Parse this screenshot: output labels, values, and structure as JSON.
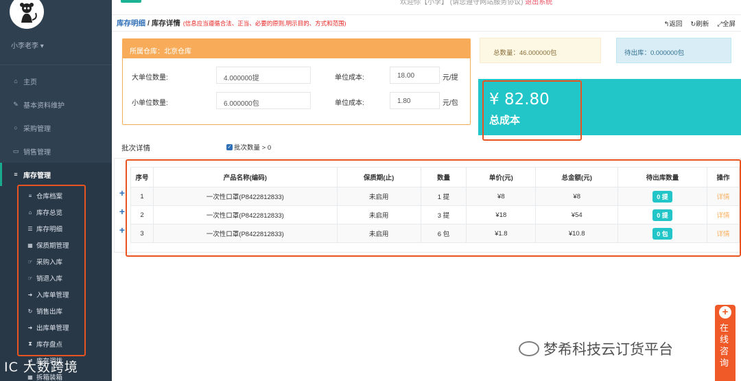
{
  "sidebar": {
    "user_name": "小李老李 ▾",
    "items": [
      {
        "icon": "home-icon",
        "glyph": "⌂",
        "label": "主页"
      },
      {
        "icon": "pencil-icon",
        "glyph": "✎",
        "label": "基本资料维护"
      },
      {
        "icon": "circle-icon",
        "glyph": "○",
        "label": "采购管理"
      },
      {
        "icon": "monitor-icon",
        "glyph": "▭",
        "label": "销售管理"
      },
      {
        "icon": "database-icon",
        "glyph": "≡",
        "label": "库存管理"
      }
    ],
    "submenu": [
      {
        "icon": "database-icon",
        "glyph": "≡",
        "label": "仓库档案"
      },
      {
        "icon": "bank-icon",
        "glyph": "⌂",
        "label": "库存总览"
      },
      {
        "icon": "list-icon",
        "glyph": "☰",
        "label": "库存明细"
      },
      {
        "icon": "calendar-icon",
        "glyph": "▦",
        "label": "保质期管理"
      },
      {
        "icon": "hand-icon",
        "glyph": "☞",
        "label": "采购入库"
      },
      {
        "icon": "hand-icon",
        "glyph": "☞",
        "label": "销退入库"
      },
      {
        "icon": "sign-in-icon",
        "glyph": "➜",
        "label": "入库单管理"
      },
      {
        "icon": "refresh-icon",
        "glyph": "↻",
        "label": "销售出库"
      },
      {
        "icon": "sign-out-icon",
        "glyph": "➜",
        "label": "出库单管理"
      },
      {
        "icon": "hourglass-icon",
        "glyph": "⧗",
        "label": "库存盘点"
      },
      {
        "icon": "exchange-icon",
        "glyph": "⇄",
        "label": "库存调拨"
      },
      {
        "icon": "table-icon",
        "glyph": "▦",
        "label": "拆箱装箱"
      }
    ]
  },
  "watermark_left": "IC 大数跨境",
  "topbar": {
    "text": "欢迎你【小李】 (请您遵守网站服务协议) ",
    "link": "退出系统"
  },
  "breadcrumb": {
    "parent": "库存明细",
    "sep": " / ",
    "current": "库存详情",
    "note": "(信息应当遵循合法、正当、必要的原则,明示目的、方式和范围)",
    "back": "↰返回",
    "refresh": "↻刷新",
    "fullscreen": "⤢全屏"
  },
  "warehouse": {
    "header": "所属仓库：北京仓库",
    "big_qty_label": "大单位数量:",
    "big_qty_value": "4.000000提",
    "big_cost_label": "单位成本:",
    "big_cost_value": "18.00",
    "big_cost_unit": "元/提",
    "small_qty_label": "小单位数量:",
    "small_qty_value": "6.000000包",
    "small_cost_label": "单位成本:",
    "small_cost_value": "1.80",
    "small_cost_unit": "元/包"
  },
  "summary": {
    "total_qty": "总数量：46.000000包",
    "pending_out": "待出库：0.000000包",
    "cost_amount": "¥ 82.80",
    "cost_label": "总成本"
  },
  "batch": {
    "title": "批次详情",
    "filter_label": "批次数量 > 0"
  },
  "table": {
    "headers": [
      "序号",
      "产品名称(编码)",
      "保质期(止)",
      "数量",
      "单价(元)",
      "总金额(元)",
      "待出库数量",
      "操作"
    ],
    "rows": [
      {
        "no": "1",
        "name": "一次性口罩(P8422812833)",
        "expiry": "未启用",
        "qty": "1 提",
        "price": "¥8",
        "total": "¥8",
        "pending": "0 提",
        "action": "详情"
      },
      {
        "no": "2",
        "name": "一次性口罩(P8422812833)",
        "expiry": "未启用",
        "qty": "3 提",
        "price": "¥18",
        "total": "¥54",
        "pending": "0 提",
        "action": "详情"
      },
      {
        "no": "3",
        "name": "一次性口罩(P8422812833)",
        "expiry": "未启用",
        "qty": "6 包",
        "price": "¥1.8",
        "total": "¥10.8",
        "pending": "0 包",
        "action": "详情"
      }
    ]
  },
  "float_button": {
    "text": "在线咨询"
  },
  "watermark_right": "梦希科技云订货平台",
  "colors": {
    "sidebar": "#2f4050",
    "accent": "#1ab394",
    "warning": "#f8ac59",
    "info": "#23c6c8",
    "highlight": "#e8531f"
  }
}
